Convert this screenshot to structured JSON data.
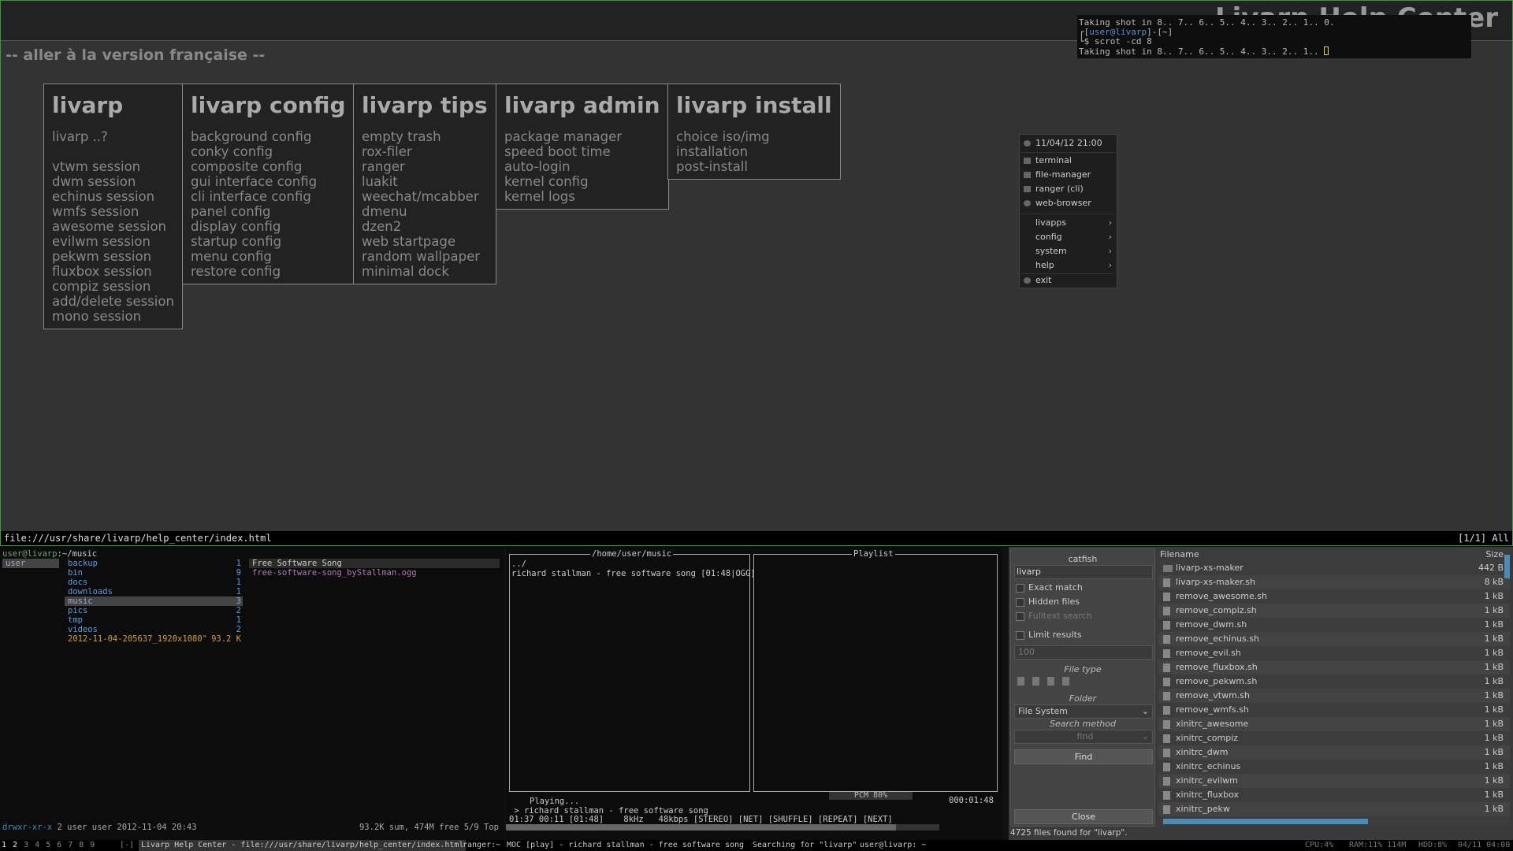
{
  "browser": {
    "page_heading": "Livarp Help Center",
    "language_link": "-- aller à la version française --",
    "url": "file:///usr/share/livarp/help_center/index.html",
    "position": "[1/1] All",
    "sections": [
      {
        "title": "livarp",
        "items": [
          "livarp ..?",
          "",
          "vtwm session",
          "dwm session",
          "echinus session",
          "wmfs session",
          "awesome session",
          "evilwm session",
          "pekwm session",
          "fluxbox session",
          "compiz session",
          "add/delete session",
          "mono session"
        ]
      },
      {
        "title": "livarp config",
        "items": [
          "background config",
          "conky config",
          "composite config",
          "gui interface config",
          "cli interface config",
          "panel config",
          "display config",
          "startup config",
          "menu config",
          "restore config"
        ]
      },
      {
        "title": "livarp tips",
        "items": [
          "empty trash",
          "rox-filer",
          "ranger",
          "luakit",
          "weechat/mcabber",
          "dmenu",
          "dzen2",
          "web startpage",
          "random wallpaper",
          "minimal dock"
        ]
      },
      {
        "title": "livarp admin",
        "items": [
          "package manager",
          "speed boot time",
          "auto-login",
          "kernel config",
          "kernel logs"
        ]
      },
      {
        "title": "livarp install",
        "items": [
          "choice iso/img",
          "installation",
          "post-install"
        ]
      }
    ]
  },
  "terminal": {
    "line1": "Taking shot in 8.. 7.. 6.. 5.. 4.. 3.. 2.. 1.. 0.",
    "prompt_user": "user@livarp",
    "prompt_rest": "]-[~]",
    "prompt_open": "┌[",
    "command": "└$ scrot -cd 8",
    "line3": "Taking shot in 8.. 7.. 6.. 5.. 4.. 3.. 2.. 1.. "
  },
  "menu": {
    "datetime": "11/04/12 21:00",
    "apps": [
      "terminal",
      "file-manager",
      "ranger (cli)",
      "web-browser"
    ],
    "submenus": [
      "livapps",
      "config",
      "system",
      "help"
    ],
    "exit": "exit",
    "arrow": "›"
  },
  "ranger": {
    "host": "user@livarp",
    "path": ":~/music",
    "parent": [
      {
        "name": "user"
      }
    ],
    "dirs": [
      {
        "name": "backup",
        "count": "1"
      },
      {
        "name": "bin",
        "count": "9"
      },
      {
        "name": "docs",
        "count": "1"
      },
      {
        "name": "downloads",
        "count": "1"
      },
      {
        "name": "music",
        "count": "3"
      },
      {
        "name": "pics",
        "count": "2"
      },
      {
        "name": "tmp",
        "count": "1"
      },
      {
        "name": "videos",
        "count": "2"
      },
      {
        "name": "2012-11-04-205637_1920x1080\"",
        "count": "93.2 K"
      }
    ],
    "preview": [
      "Free Software Song",
      "free-software-song_byStallman.ogg"
    ],
    "status_perm": "drwxr-xr-x",
    "status_info": " 2 user user 2012-11-04 20:43",
    "status_right": "93.2K sum, 474M free  5/9  Top"
  },
  "moc": {
    "dir_title": "/home/user/music",
    "playlist_title": "Playlist",
    "up": "../",
    "track_line": "richard stallman - free software song  [01:48|OGG]",
    "playing": "Playing...",
    "now": " > richard stallman - free software song",
    "info": "01:37 00:11 [01:48]    8kHz   48kbps [STEREO] [NET] [SHUFFLE] [REPEAT] [NEXT]",
    "mixer": "PCM  80%",
    "time": "000:01:48",
    "progress": 0.9
  },
  "catfish": {
    "title": "catfish",
    "query": "livarp",
    "exact_match": "Exact match",
    "hidden_files": "Hidden files",
    "fulltext": "Fulltext search",
    "limit_results": "Limit results",
    "limit_value": "100",
    "file_type": "File type",
    "folder": "Folder",
    "folder_value": "File System",
    "search_method": "Search method",
    "method_value": "find",
    "find": "Find",
    "close": "Close",
    "col_filename": "Filename",
    "col_size": "Size",
    "files": [
      {
        "name": "livarp-xs-maker",
        "size": "442 B",
        "folder": true
      },
      {
        "name": "livarp-xs-maker.sh",
        "size": "8 kB"
      },
      {
        "name": "remove_awesome.sh",
        "size": "1 kB"
      },
      {
        "name": "remove_compiz.sh",
        "size": "1 kB"
      },
      {
        "name": "remove_dwm.sh",
        "size": "1 kB"
      },
      {
        "name": "remove_echinus.sh",
        "size": "1 kB"
      },
      {
        "name": "remove_evil.sh",
        "size": "1 kB"
      },
      {
        "name": "remove_fluxbox.sh",
        "size": "1 kB"
      },
      {
        "name": "remove_pekwm.sh",
        "size": "1 kB"
      },
      {
        "name": "remove_vtwm.sh",
        "size": "1 kB"
      },
      {
        "name": "remove_wmfs.sh",
        "size": "1 kB"
      },
      {
        "name": "xinitrc_awesome",
        "size": "1 kB"
      },
      {
        "name": "xinitrc_compiz",
        "size": "1 kB"
      },
      {
        "name": "xinitrc_dwm",
        "size": "1 kB"
      },
      {
        "name": "xinitrc_echinus",
        "size": "1 kB"
      },
      {
        "name": "xinitrc_evilwm",
        "size": "1 kB"
      },
      {
        "name": "xinitrc_fluxbox",
        "size": "1 kB"
      },
      {
        "name": "xinitrc_pekw",
        "size": "1 kB"
      }
    ],
    "status": "4725 files found for \"livarp\"."
  },
  "panel": {
    "workspaces": [
      "1",
      "2",
      "3",
      "4",
      "5",
      "6",
      "7",
      "8",
      "9"
    ],
    "layout": "[-]",
    "tasks": [
      "Livarp Help Center - file:///usr/share/livarp/help_center/index.html",
      "ranger:~",
      "MOC [play] - richard stallman - free software song",
      "Searching for \"livarp\"",
      "user@livarp: ~"
    ],
    "cpu": "CPU:4%",
    "ram": "RAM:11% 114M",
    "hdd": "HDD:8%",
    "clock": "04/11 04:00"
  },
  "colors": {
    "accent_green": "#3a9a3a",
    "selection_blue": "#4c8ab8"
  }
}
